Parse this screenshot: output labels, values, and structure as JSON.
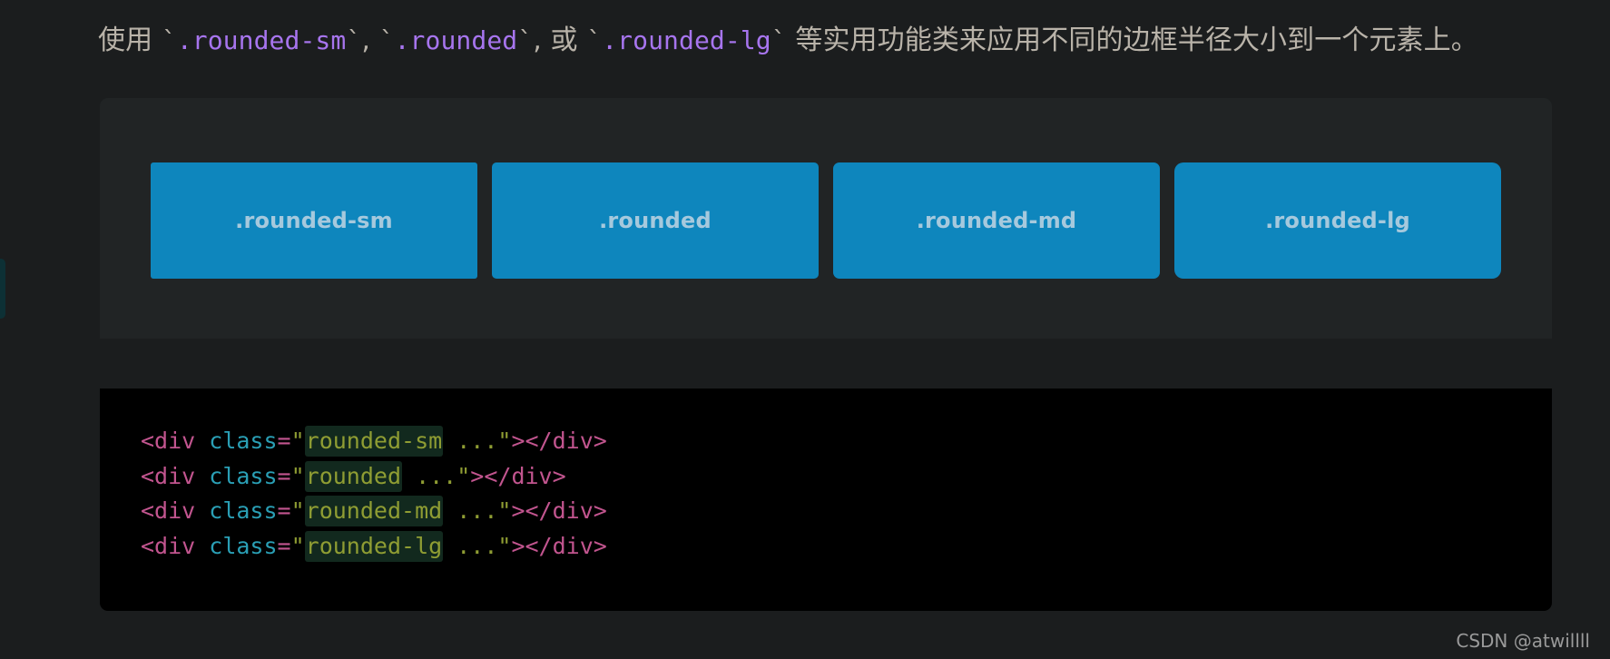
{
  "page": {
    "background_color": "#1b1d1e",
    "watermark": "CSDN @atwillll"
  },
  "heading": {
    "prefix": "使用 ",
    "code_1": ".rounded-sm",
    "sep_1": ", ",
    "code_2": ".rounded",
    "sep_2": ", 或 ",
    "code_3": ".rounded-lg",
    "suffix": " 等实用功能类来应用不同的边框半径大小到一个元素上。",
    "text_color": "#b9b3a9",
    "code_color": "#a775ee"
  },
  "preview": {
    "background_color": "#212425",
    "box_color": "#0e86bd",
    "box_text_color": "#a6c9dd",
    "boxes": [
      {
        "label": ".rounded-sm",
        "radius": "3px"
      },
      {
        "label": ".rounded",
        "radius": "5px"
      },
      {
        "label": ".rounded-md",
        "radius": "7px"
      },
      {
        "label": ".rounded-lg",
        "radius": "10px"
      }
    ]
  },
  "code": {
    "background_color": "#000000",
    "highlight_color": "#12291e",
    "lines": [
      {
        "open": "<div ",
        "attr": "class",
        "eq": "=",
        "quote_open": "\"",
        "highlight": "rounded-sm",
        "rest": " ...",
        "quote_close": "\"",
        "close": "></div>"
      },
      {
        "open": "<div ",
        "attr": "class",
        "eq": "=",
        "quote_open": "\"",
        "highlight": "rounded",
        "rest": " ...",
        "quote_close": "\"",
        "close": "></div>"
      },
      {
        "open": "<div ",
        "attr": "class",
        "eq": "=",
        "quote_open": "\"",
        "highlight": "rounded-md",
        "rest": " ...",
        "quote_close": "\"",
        "close": "></div>"
      },
      {
        "open": "<div ",
        "attr": "class",
        "eq": "=",
        "quote_open": "\"",
        "highlight": "rounded-lg",
        "rest": " ...",
        "quote_close": "\"",
        "close": "></div>"
      }
    ]
  }
}
